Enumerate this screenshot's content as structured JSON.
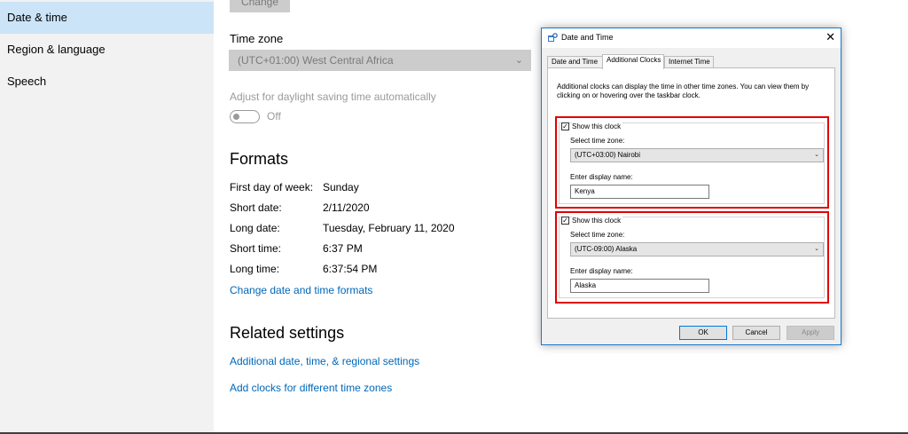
{
  "sidebar": {
    "items": [
      {
        "label": "Date & time",
        "active": true
      },
      {
        "label": "Region & language",
        "active": false
      },
      {
        "label": "Speech",
        "active": false
      }
    ]
  },
  "main": {
    "change_button": "Change",
    "time_zone": {
      "label": "Time zone",
      "value": "(UTC+01:00) West Central Africa"
    },
    "daylight": {
      "label": "Adjust for daylight saving time automatically",
      "state": "Off"
    },
    "formats": {
      "title": "Formats",
      "rows": [
        {
          "label": "First day of week:",
          "value": "Sunday"
        },
        {
          "label": "Short date:",
          "value": "2/11/2020"
        },
        {
          "label": "Long date:",
          "value": "Tuesday, February 11, 2020"
        },
        {
          "label": "Short time:",
          "value": "6:37 PM"
        },
        {
          "label": "Long time:",
          "value": "6:37:54 PM"
        }
      ],
      "link": "Change date and time formats"
    },
    "related": {
      "title": "Related settings",
      "links": [
        "Additional date, time, & regional settings",
        "Add clocks for different time zones"
      ]
    }
  },
  "dialog": {
    "title": "Date and Time",
    "close_glyph": "✕",
    "tabs": [
      {
        "label": "Date and Time",
        "active": false
      },
      {
        "label": "Additional Clocks",
        "active": true
      },
      {
        "label": "Internet Time",
        "active": false
      }
    ],
    "description": "Additional clocks can display the time in other time zones. You can view them by clicking on or hovering over the taskbar clock.",
    "clocks": [
      {
        "show_label": "Show this clock",
        "checked": true,
        "tz_label": "Select time zone:",
        "tz_value": "(UTC+03:00) Nairobi",
        "name_label": "Enter display name:",
        "name_value": "Kenya"
      },
      {
        "show_label": "Show this clock",
        "checked": true,
        "tz_label": "Select time zone:",
        "tz_value": "(UTC-09:00) Alaska",
        "name_label": "Enter display name:",
        "name_value": "Alaska"
      }
    ],
    "buttons": {
      "ok": "OK",
      "cancel": "Cancel",
      "apply": "Apply"
    },
    "highlight_color": "#e00000",
    "accent_color": "#0078d7"
  }
}
